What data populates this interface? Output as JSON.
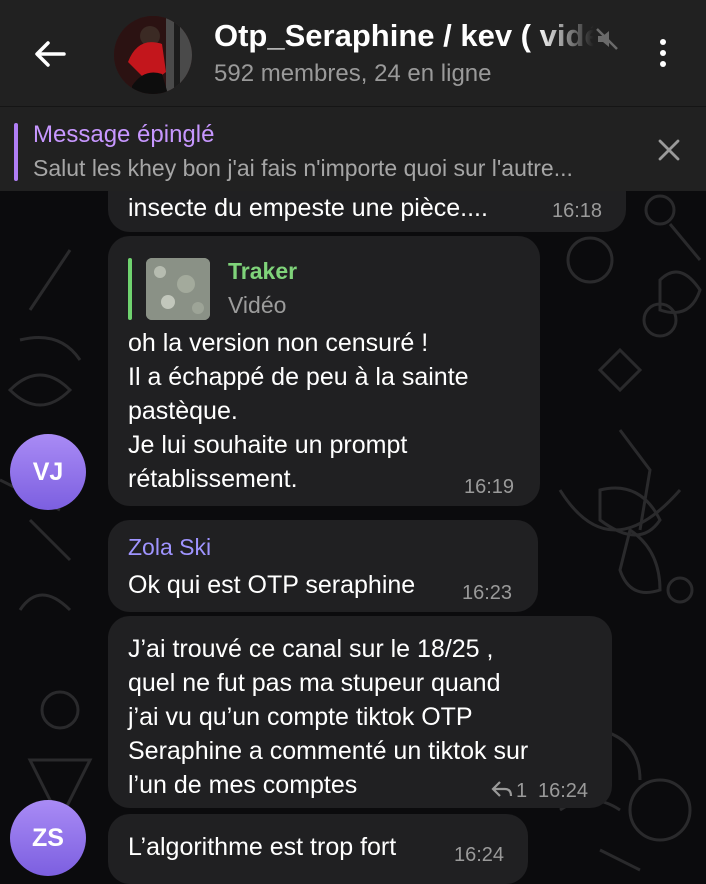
{
  "header": {
    "title": "Otp_Seraphine / kev ( vidéos",
    "subtitle": "592 membres, 24 en ligne"
  },
  "pinned": {
    "label": "Message épinglé",
    "text": "Salut les khey bon j'ai fais n'importe quoi sur l'autre..."
  },
  "messages": [
    {
      "text": "insecte du empeste une pièce....",
      "time": "16:18"
    },
    {
      "reply": {
        "name": "Traker",
        "kind": "Vidéo"
      },
      "lines": [
        "oh la version non censuré !",
        "Il a échappé de peu à la sainte",
        "pastèque.",
        "Je lui souhaite un prompt",
        "rétablissement."
      ],
      "time": "16:19",
      "avatar": "VJ"
    },
    {
      "sender": "Zola Ski",
      "text": "Ok qui est OTP seraphine",
      "time": "16:23"
    },
    {
      "lines": [
        "J’ai trouvé ce canal sur le 18/25 ,",
        "quel ne fut pas ma stupeur quand",
        "j’ai vu qu’un compte tiktok OTP",
        "Seraphine a commenté un tiktok sur",
        "l’un de mes comptes"
      ],
      "replies": "1",
      "time": "16:24"
    },
    {
      "text": "L’algorithme est trop fort",
      "time": "16:24",
      "avatar": "ZS"
    }
  ],
  "colors": {
    "header_bg": "#212121",
    "bubble_bg": "#202022",
    "accent_purple": "#c797ff",
    "reply_green": "#7fd37a",
    "sender_color": "#9f94ff"
  },
  "icons": [
    "back-arrow-icon",
    "mute-icon",
    "more-vert-icon",
    "close-icon",
    "reply-arrow-icon"
  ]
}
